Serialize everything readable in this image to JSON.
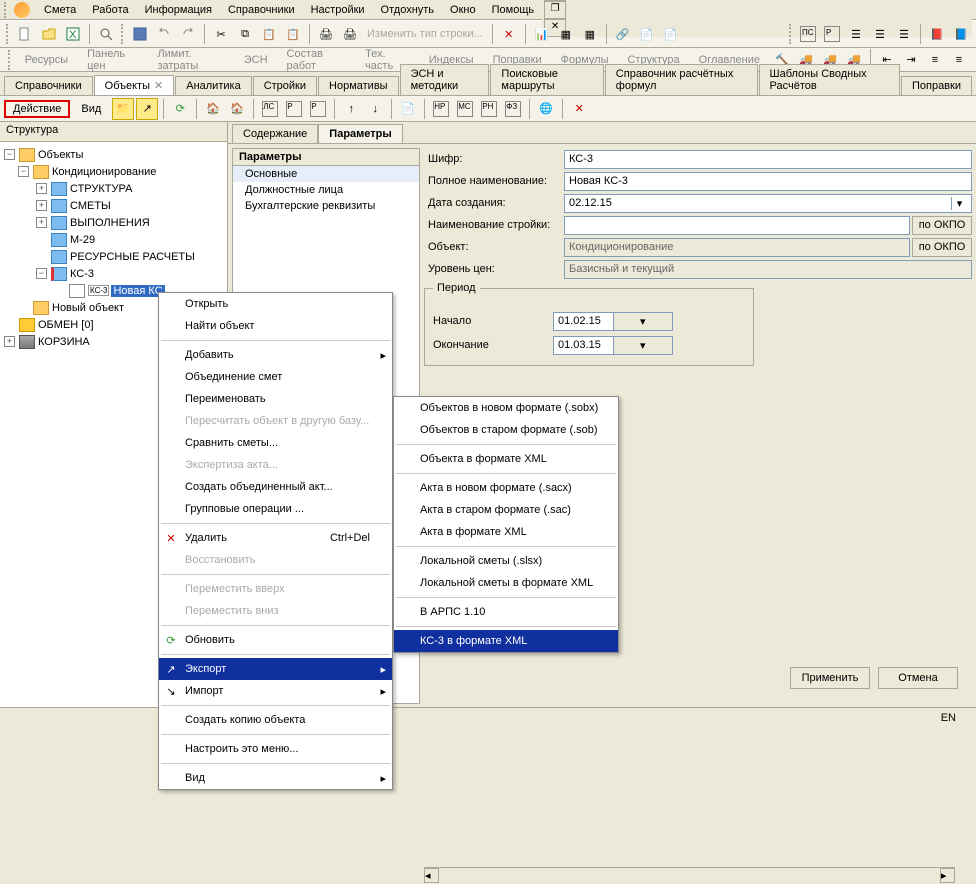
{
  "menubar": {
    "items": [
      "Смета",
      "Работа",
      "Информация",
      "Справочники",
      "Настройки",
      "Отдохнуть",
      "Окно",
      "Помощь"
    ]
  },
  "toolbar1": {
    "change_type": "Изменить тип строки..."
  },
  "toolbar2": {
    "items": [
      "Ресурсы",
      "Панель цен",
      "Лимит. затраты",
      "ЭСН",
      "Состав работ",
      "Тех. часть",
      "Индексы",
      "Поправки",
      "Формулы",
      "Структура",
      "Оглавление"
    ]
  },
  "tabs": {
    "items": [
      "Справочники",
      "Объекты",
      "Аналитика",
      "Стройки",
      "Нормативы",
      "ЭСН и методики",
      "Поисковые маршруты",
      "Справочник расчётных формул",
      "Шаблоны Сводных Расчётов",
      "Поправки"
    ],
    "active": 1
  },
  "actionbar": {
    "action": "Действие",
    "view": "Вид"
  },
  "left_panel": {
    "title": "Структура",
    "tree": {
      "root": "Объекты",
      "cond": "Кондиционирование",
      "struct": "СТРУКТУРА",
      "smety": "СМЕТЫ",
      "vypoln": "ВЫПОЛНЕНИЯ",
      "m29": "М-29",
      "res": "РЕСУРСНЫЕ РАСЧЕТЫ",
      "kc3": "КС-3",
      "kc3_pref": "КС-3",
      "new_kc": "Новая КС",
      "new_obj": "Новый объект",
      "obmen": "ОБМЕН  [0]",
      "korzina": "КОРЗИНА"
    }
  },
  "subtabs": {
    "items": [
      "Содержание",
      "Параметры"
    ],
    "active": 1
  },
  "param_tree": {
    "hdr": "Параметры",
    "items": [
      "Основные",
      "Должностные лица",
      "Бухгалтерские реквизиты"
    ]
  },
  "form": {
    "labels": {
      "shifr": "Шифр:",
      "full_name": "Полное наименование:",
      "date_created": "Дата создания:",
      "stroika_name": "Наименование стройки:",
      "object": "Объект:",
      "price_level": "Уровень цен:",
      "okpo": "по ОКПО"
    },
    "values": {
      "shifr": "КС-3",
      "full_name": "Новая КС-3",
      "date_created": "02.12.15",
      "stroika_name": "",
      "object": "Кондиционирование",
      "price_level": "Базисный и текущий"
    },
    "period": {
      "legend": "Период",
      "start_lbl": "Начало",
      "end_lbl": "Окончание",
      "start": "01.02.15",
      "end": "01.03.15"
    }
  },
  "ctx1": {
    "open": "Открыть",
    "find": "Найти объект",
    "add": "Добавить",
    "merge": "Объединение смет",
    "rename": "Переименовать",
    "recalc": "Пересчитать объект в другую базу...",
    "compare": "Сравнить сметы...",
    "expertise": "Экспертиза акта...",
    "merged_act": "Создать объединенный акт...",
    "group_ops": "Групповые операции ...",
    "delete": "Удалить",
    "delete_sc": "Ctrl+Del",
    "restore": "Восстановить",
    "move_up": "Переместить вверх",
    "move_down": "Переместить вниз",
    "refresh": "Обновить",
    "export": "Экспорт",
    "import": "Импорт",
    "copy": "Создать копию объекта",
    "customize": "Настроить это меню...",
    "view": "Вид"
  },
  "ctx2": {
    "items": [
      "Объектов в новом формате (.sobx)",
      "Объектов в старом формате (.sob)",
      "Объекта в формате XML",
      "Акта в новом формате (.sacx)",
      "Акта в старом формате (.sac)",
      "Акта в формате XML",
      "Локальной сметы (.slsx)",
      "Локальной сметы в формате XML",
      "В АРПС 1.10",
      "КС-3 в формате XML"
    ]
  },
  "footer": {
    "apply": "Применить",
    "cancel": "Отмена"
  },
  "status": {
    "lang": "EN"
  }
}
